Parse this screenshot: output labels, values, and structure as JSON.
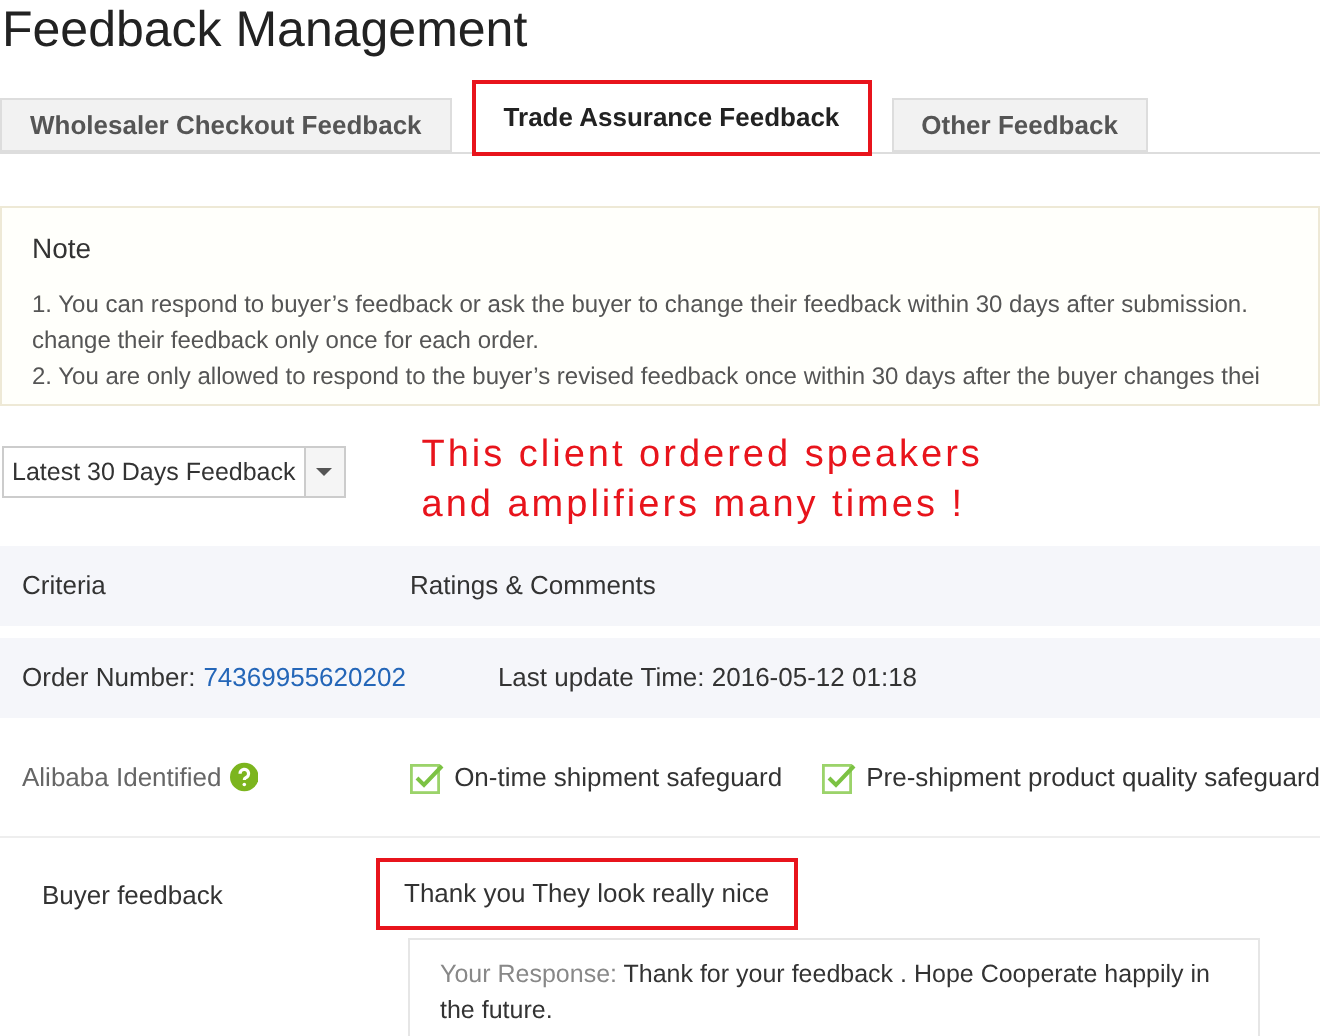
{
  "title": "Feedback Management",
  "tabs": [
    {
      "label": "Wholesaler Checkout Feedback",
      "selected": false,
      "marked": false
    },
    {
      "label": "Trade Assurance Feedback",
      "selected": true,
      "marked": true
    },
    {
      "label": "Other Feedback",
      "selected": false,
      "marked": false
    }
  ],
  "note": {
    "heading": "Note",
    "lines": [
      "1. You can respond to buyer’s feedback or ask the buyer to change their feedback within 30 days after submission.",
      "change their feedback only once for each order.",
      "2. You are only allowed to respond to the buyer’s revised feedback once within 30 days after the buyer changes thei"
    ]
  },
  "filter": {
    "value": "Latest 30 Days Feedback"
  },
  "annotation": [
    "This client ordered speakers",
    "and amplifiers many times !"
  ],
  "table": {
    "columns": [
      "Criteria",
      "Ratings & Comments"
    ],
    "order": {
      "label": "Order Number:",
      "number": "74369955620202",
      "update": "Last update Time: 2016-05-12 01:18"
    },
    "identified": {
      "label": "Alibaba Identified",
      "safeguards": [
        {
          "label": "On-time shipment safeguard",
          "checked": true
        },
        {
          "label": "Pre-shipment product quality safeguard",
          "checked": true
        }
      ]
    },
    "feedback": {
      "label": "Buyer feedback",
      "text": "Thank you They look really nice",
      "marked": true,
      "response_label": "Your Response:",
      "response": "Thank for your feedback . Hope Cooperate happily in the future."
    }
  }
}
